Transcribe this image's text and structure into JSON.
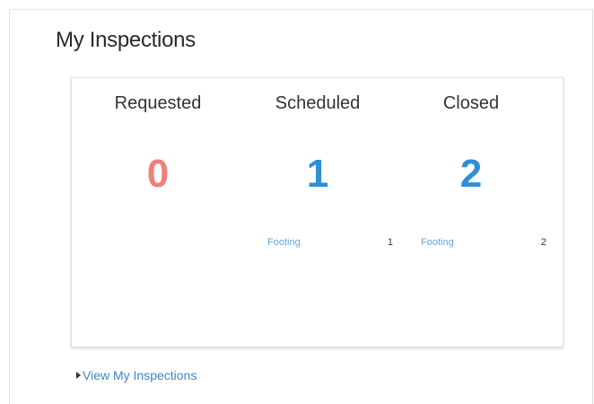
{
  "widget": {
    "title": "My Inspections",
    "link_label": "View My Inspections"
  },
  "columns": [
    {
      "label": "Requested",
      "count": "0",
      "color": "#f08078",
      "breakdown": []
    },
    {
      "label": "Scheduled",
      "count": "1",
      "color": "#2f8fd5",
      "breakdown": [
        {
          "type": "Footing",
          "count": "1"
        }
      ]
    },
    {
      "label": "Closed",
      "count": "2",
      "color": "#2f8fd5",
      "breakdown": [
        {
          "type": "Footing",
          "count": "2"
        }
      ]
    }
  ],
  "colors": {
    "requested": "#f08078",
    "scheduled": "#2f8fd5",
    "closed": "#2f8fd5",
    "link": "#3e86c8"
  },
  "icons": {
    "link_bullet": "caret-right-icon"
  }
}
